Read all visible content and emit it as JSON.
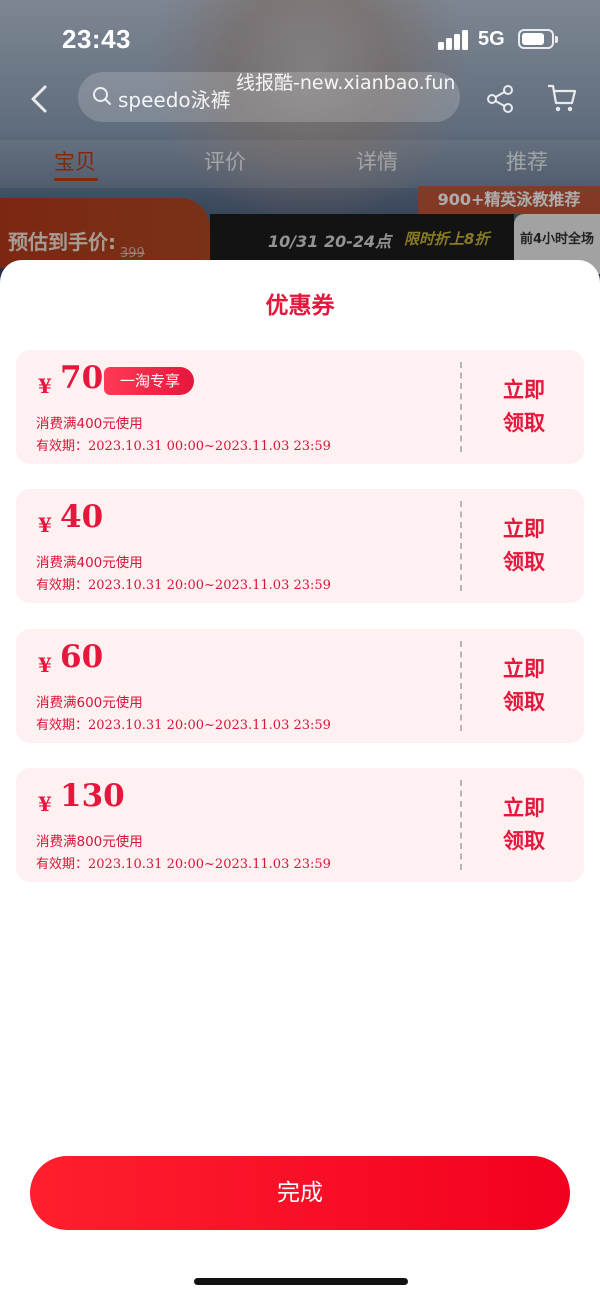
{
  "status_bar": {
    "time": "23:43",
    "network": "5G"
  },
  "watermark": "线报酷-new.xianbao.fun",
  "header": {
    "search_placeholder": "speedo泳裤"
  },
  "tabs": [
    {
      "label": "宝贝",
      "active": true
    },
    {
      "label": "评价",
      "active": false
    },
    {
      "label": "详情",
      "active": false
    },
    {
      "label": "推荐",
      "active": false
    }
  ],
  "banner": {
    "promo_tag": "900+精英泳教推荐",
    "price_label": "预估到手价:",
    "original_price": "399",
    "event_time": "10/31 20-24点",
    "event_discount": "限时折上8折",
    "side_text": "前4小时全场"
  },
  "sheet": {
    "title": "优惠券",
    "coupons": [
      {
        "currency": "¥",
        "amount": "70",
        "tag": "一淘专享",
        "condition": "消费满400元使用",
        "validity": "有效期：2023.10.31 00:00~2023.11.03 23:59",
        "claim": "立即\n领取"
      },
      {
        "currency": "¥",
        "amount": "40",
        "tag": "",
        "condition": "消费满400元使用",
        "validity": "有效期：2023.10.31 20:00~2023.11.03 23:59",
        "claim": "立即\n领取"
      },
      {
        "currency": "¥",
        "amount": "60",
        "tag": "",
        "condition": "消费满600元使用",
        "validity": "有效期：2023.10.31 20:00~2023.11.03 23:59",
        "claim": "立即\n领取"
      },
      {
        "currency": "¥",
        "amount": "130",
        "tag": "",
        "condition": "消费满800元使用",
        "validity": "有效期：2023.10.31 20:00~2023.11.03 23:59",
        "claim": "立即\n领取"
      }
    ],
    "done_label": "完成"
  },
  "colors": {
    "accent": "#e4173c",
    "coupon_bg": "#fff1f1",
    "button": "#ff1f2d"
  }
}
